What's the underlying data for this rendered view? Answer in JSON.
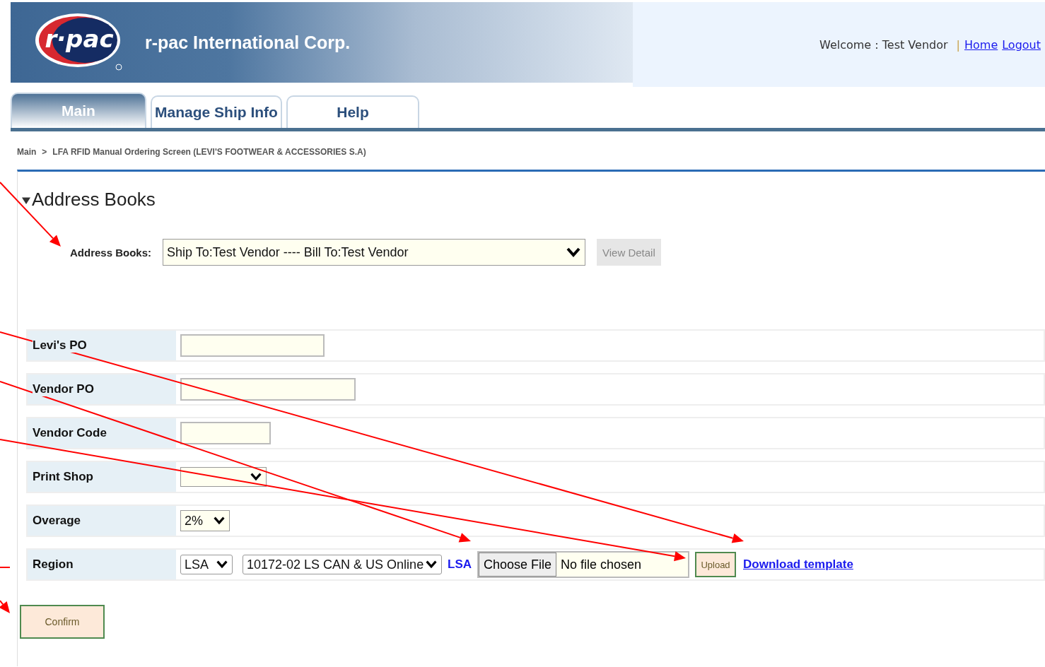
{
  "header": {
    "company": "r-pac International Corp.",
    "logo_text": "r·pac",
    "welcome": "Welcome : Test Vendor",
    "separator": "|",
    "links": [
      {
        "label": "Home"
      },
      {
        "label": "Logout"
      }
    ]
  },
  "tabs": [
    {
      "label": "Main",
      "selected": true
    },
    {
      "label": "Manage Ship Info",
      "selected": false
    },
    {
      "label": "Help",
      "selected": false
    }
  ],
  "breadcrumb": {
    "items": [
      "Main",
      "LFA RFID Manual Ordering Screen (LEVI'S FOOTWEAR & ACCESSORIES S.A)"
    ],
    "separator": ">"
  },
  "address_section": {
    "title": "Address Books",
    "expanded": true,
    "label": "Address Books:",
    "value": "Ship To:Test Vendor ---- Bill To:Test Vendor",
    "button": "View Detail"
  },
  "form_rows": [
    {
      "label": "Levi's PO",
      "kind": "text"
    },
    {
      "label": "Vendor PO",
      "kind": "text"
    },
    {
      "label": "Vendor Code",
      "kind": "text"
    },
    {
      "label": "Print Shop",
      "kind": "select"
    },
    {
      "label": "Overage",
      "kind": "select",
      "value": "2%"
    },
    {
      "label": "Region",
      "kind": "region",
      "region": "LSA",
      "location": "10172-02 LS CAN & US Online",
      "region_code": "LSA",
      "file_button": "Choose File",
      "file_status": "No file chosen",
      "upload": "Upload",
      "download": "Download template"
    }
  ],
  "confirm": "Confirm"
}
